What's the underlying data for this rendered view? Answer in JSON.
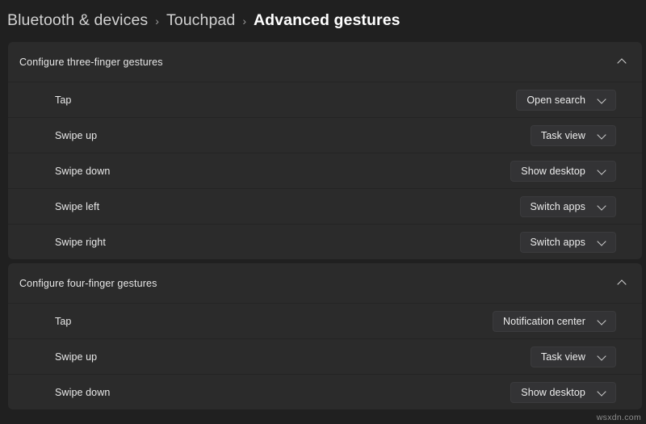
{
  "breadcrumb": {
    "separator": "›",
    "items": [
      {
        "label": "Bluetooth & devices",
        "current": false
      },
      {
        "label": "Touchpad",
        "current": false
      },
      {
        "label": "Advanced gestures",
        "current": true
      }
    ]
  },
  "sections": [
    {
      "title": "Configure three-finger gestures",
      "toggle_icon": "chevron-up-icon",
      "expanded": true,
      "rows": [
        {
          "label": "Tap",
          "value": "Open search",
          "icon": "chevron-down-icon"
        },
        {
          "label": "Swipe up",
          "value": "Task view",
          "icon": "chevron-down-icon"
        },
        {
          "label": "Swipe down",
          "value": "Show desktop",
          "icon": "chevron-down-icon"
        },
        {
          "label": "Swipe left",
          "value": "Switch apps",
          "icon": "chevron-down-icon"
        },
        {
          "label": "Swipe right",
          "value": "Switch apps",
          "icon": "chevron-down-icon"
        }
      ]
    },
    {
      "title": "Configure four-finger gestures",
      "toggle_icon": "chevron-up-icon",
      "expanded": true,
      "rows": [
        {
          "label": "Tap",
          "value": "Notification center",
          "icon": "chevron-down-icon"
        },
        {
          "label": "Swipe up",
          "value": "Task view",
          "icon": "chevron-down-icon"
        },
        {
          "label": "Swipe down",
          "value": "Show desktop",
          "icon": "chevron-down-icon"
        }
      ]
    }
  ],
  "watermark": "wsxdn.com",
  "colors": {
    "page_background": "#202020",
    "card_background": "#2b2b2b",
    "combo_background": "#333335",
    "divider": "#242424",
    "text_primary": "#ffffff",
    "text_secondary": "#cfcfcf"
  }
}
